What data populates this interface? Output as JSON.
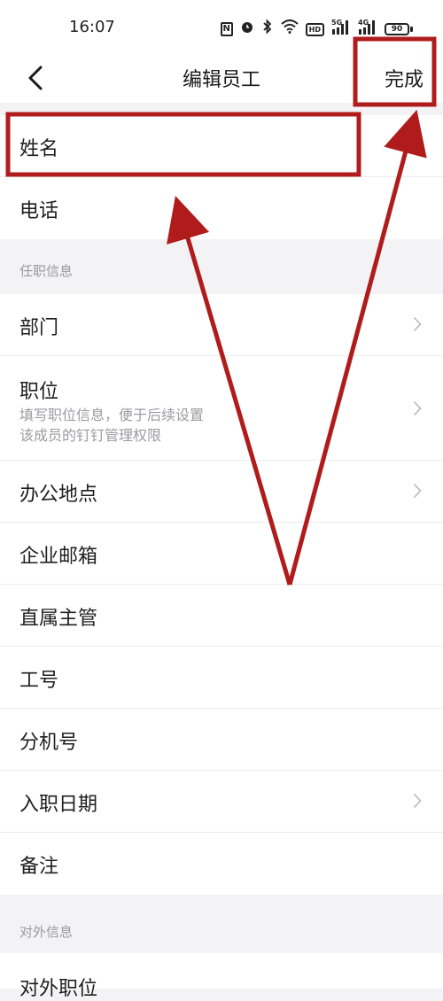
{
  "status_bar": {
    "time": "16:07",
    "icons": [
      "nfc-icon",
      "alarm-icon",
      "bluetooth-icon",
      "wifi-icon",
      "hd-icon",
      "signal-5g-icon",
      "signal-4g-icon",
      "battery-icon"
    ],
    "signal_5g": "5G",
    "signal_4g": "4G",
    "hd": "HD",
    "battery": "90"
  },
  "header": {
    "title": "编辑员工",
    "done_label": "完成"
  },
  "basic_info": [
    {
      "label": "姓名"
    },
    {
      "label": "电话"
    }
  ],
  "job_section": {
    "title": "任职信息",
    "department": "部门",
    "position": "职位",
    "position_hint_line1": "填写职位信息，便于后续设置",
    "position_hint_line2": "该成员的钉钉管理权限",
    "office_location": "办公地点",
    "email": "企业邮箱",
    "supervisor": "直属主管",
    "employee_id": "工号",
    "extension": "分机号",
    "hire_date": "入职日期",
    "remarks": "备注"
  },
  "external_section": {
    "title": "对外信息",
    "external_position": "对外职位"
  },
  "annotation_color": "#b01c1c"
}
